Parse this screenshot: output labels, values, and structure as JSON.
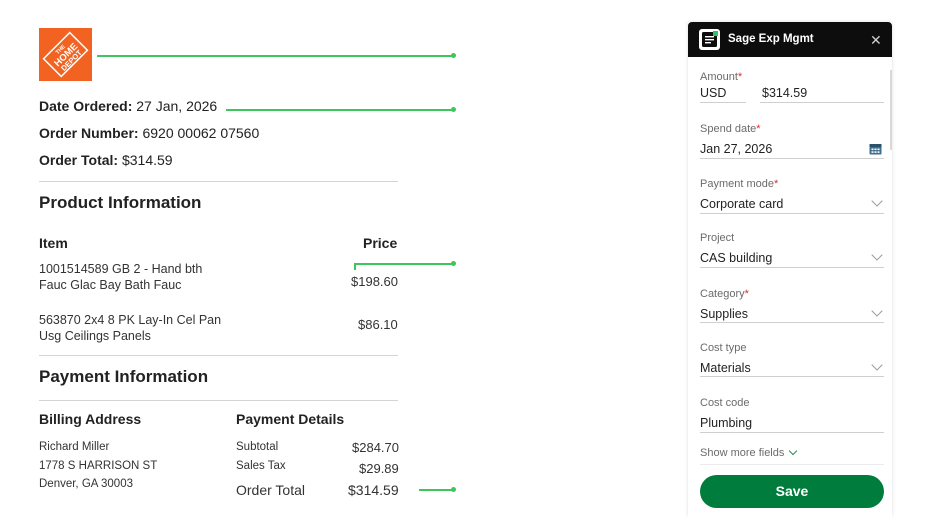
{
  "receipt": {
    "logo_text": "THE HOME DEPOT",
    "date_ordered_label": "Date Ordered:",
    "date_ordered": "27 Jan, 2026",
    "order_number_label": "Order Number:",
    "order_number": "6920 00062 07560",
    "order_total_label": "Order Total:",
    "order_total": "$314.59",
    "product_section_title": "Product Information",
    "col_item": "Item",
    "col_price": "Price",
    "items": [
      {
        "line1": "1001514589 GB 2 - Hand bth",
        "line2": "Fauc Glac Bay Bath Fauc",
        "price": "$198.60"
      },
      {
        "line1": "563870 2x4 8 PK Lay-In Cel Pan",
        "line2": "Usg Ceilings Panels",
        "price": "$86.10"
      }
    ],
    "payment_section_title": "Payment Information",
    "billing_address_title": "Billing Address",
    "payment_details_title": "Payment Details",
    "billing": {
      "name": "Richard Miller",
      "street": "1778 S HARRISON ST",
      "city": "Denver, GA 30003"
    },
    "payment": {
      "subtotal_label": "Subtotal",
      "subtotal": "$284.70",
      "tax_label": "Sales Tax",
      "tax": "$29.89",
      "total_label": "Order Total",
      "total": "$314.59"
    }
  },
  "panel": {
    "app_title": "Sage Exp Mgmt",
    "close_icon": "close-icon",
    "fields": {
      "amount_label": "Amount",
      "currency": "USD",
      "amount": "$314.59",
      "spend_date_label": "Spend date",
      "spend_date": "Jan 27, 2026",
      "payment_mode_label": "Payment mode",
      "payment_mode": "Corporate card",
      "project_label": "Project",
      "project": "CAS building",
      "category_label": "Category",
      "category": "Supplies",
      "cost_type_label": "Cost type",
      "cost_type": "Materials",
      "cost_code_label": "Cost code",
      "cost_code": "Plumbing"
    },
    "required_mark": "*",
    "show_more": "Show more fields",
    "save_label": "Save"
  },
  "colors": {
    "brand_orange": "#f26322",
    "save_green": "#007c3d",
    "annotation_green": "#3fc65a",
    "required_red": "#d93030"
  }
}
